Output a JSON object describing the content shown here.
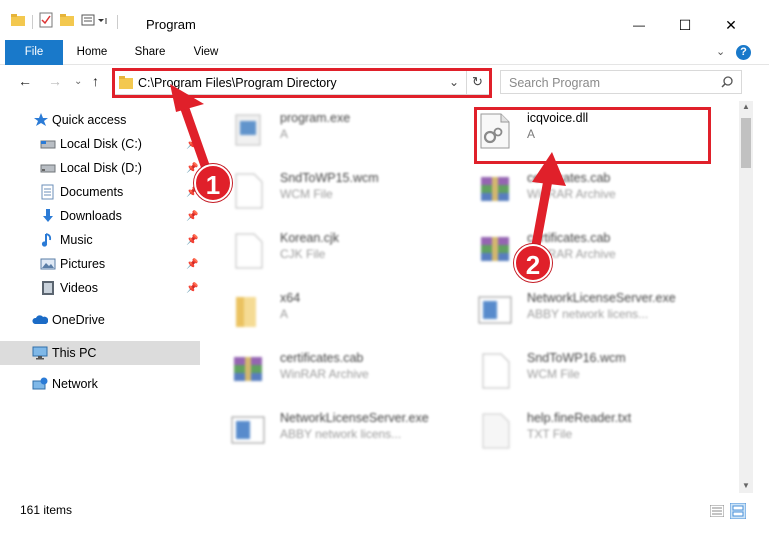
{
  "window": {
    "title": "Program",
    "minimize": "—",
    "maximize": "☐",
    "close": "✕"
  },
  "ribbon": {
    "tabs": [
      {
        "label": "File"
      },
      {
        "label": "Home"
      },
      {
        "label": "Share"
      },
      {
        "label": "View"
      }
    ]
  },
  "address": {
    "path": "C:\\Program Files\\Program Directory",
    "search_placeholder": "Search Program"
  },
  "sidebar": {
    "items": [
      {
        "label": "Quick access"
      },
      {
        "label": "Local Disk (C:)"
      },
      {
        "label": "Local Disk (D:)"
      },
      {
        "label": "Documents"
      },
      {
        "label": "Downloads"
      },
      {
        "label": "Music"
      },
      {
        "label": "Pictures"
      },
      {
        "label": "Videos"
      },
      {
        "label": "OneDrive"
      },
      {
        "label": "This PC"
      },
      {
        "label": "Network"
      }
    ]
  },
  "files": [
    {
      "name": "program.exe",
      "type": "A"
    },
    {
      "name": "icqvoice.dll",
      "type": "A"
    },
    {
      "name": "SndToWP15.wcm",
      "type": "WCM File"
    },
    {
      "name": "certificates.cab",
      "type": "WinRAR Archive"
    },
    {
      "name": "Korean.cjk",
      "type": "CJK File"
    },
    {
      "name": "certificates.cab",
      "type": "WinRAR Archive"
    },
    {
      "name": "x64",
      "type": "A"
    },
    {
      "name": "NetworkLicenseServer.exe",
      "type": "ABBY network licens..."
    },
    {
      "name": "certificates.cab",
      "type": "WinRAR Archive"
    },
    {
      "name": "SndToWP16.wcm",
      "type": "WCM File"
    },
    {
      "name": "NetworkLicenseServer.exe",
      "type": "ABBY network licens..."
    },
    {
      "name": "help.fineReader.txt",
      "type": "TXT File"
    }
  ],
  "status": {
    "item_count": "161 items"
  },
  "annotations": {
    "step1": "1",
    "step2": "2"
  },
  "colors": {
    "accent": "#1979ca",
    "highlight": "#e0202a"
  }
}
